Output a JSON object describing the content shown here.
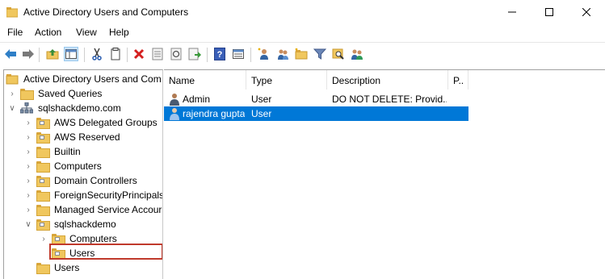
{
  "window": {
    "title": "Active Directory Users and Computers"
  },
  "menu": [
    "File",
    "Action",
    "View",
    "Help"
  ],
  "toolbar": {
    "buttons": [
      "back-icon",
      "forward-icon",
      "up-folder-icon",
      "console-tree-icon",
      "cut-icon",
      "copy-icon",
      "delete-icon",
      "properties-icon",
      "refresh-icon",
      "export-icon",
      "help-icon",
      "show-details-icon",
      "new-user-icon",
      "new-group-icon",
      "new-ou-icon",
      "filter-icon",
      "find-icon",
      "add-to-group-icon"
    ]
  },
  "tree": {
    "root": "Active Directory Users and Com",
    "saved_queries": "Saved Queries",
    "domain": "sqlshackdemo.com",
    "children": [
      "AWS Delegated Groups",
      "AWS Reserved",
      "Builtin",
      "Computers",
      "Domain Controllers",
      "ForeignSecurityPrincipals",
      "Managed Service Accour",
      "sqlshackdemo"
    ],
    "ou_children": [
      "Computers",
      "Users"
    ],
    "users_container": "Users"
  },
  "list": {
    "columns": [
      "Name",
      "Type",
      "Description",
      "P.."
    ],
    "rows": [
      {
        "name": "Admin",
        "type": "User",
        "description": "DO NOT DELETE:  Provid..."
      },
      {
        "name": "rajendra gupta",
        "type": "User",
        "description": ""
      }
    ]
  },
  "colors": {
    "selection": "#0078d7",
    "highlight_box": "#c0392b",
    "folder": "#f0c75e"
  }
}
